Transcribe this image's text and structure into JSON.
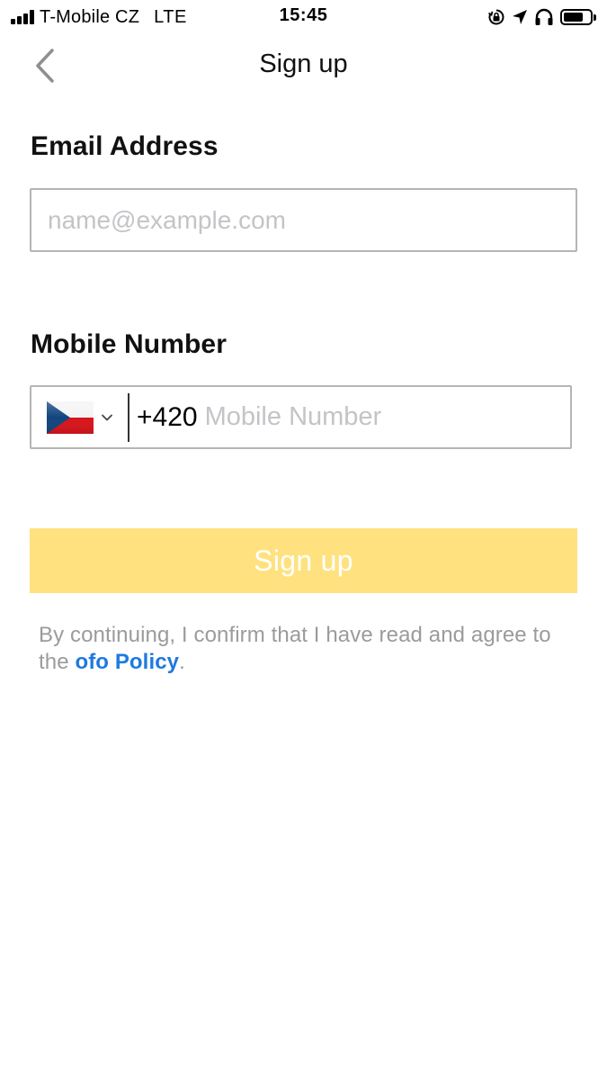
{
  "status_bar": {
    "carrier": "T-Mobile CZ",
    "network": "LTE",
    "time": "15:45",
    "icons": [
      "signal-bars-icon",
      "orientation-lock-icon",
      "location-arrow-icon",
      "headphones-icon",
      "battery-icon"
    ],
    "battery_level": 0.75
  },
  "nav": {
    "back_icon": "chevron-left-icon",
    "title": "Sign up"
  },
  "email": {
    "label": "Email Address",
    "placeholder": "name@example.com",
    "value": ""
  },
  "mobile": {
    "label": "Mobile Number",
    "country_flag": "czech-flag-icon",
    "dial_code": "+420",
    "placeholder": "Mobile Number",
    "value": ""
  },
  "signup_button": {
    "label": "Sign up"
  },
  "terms": {
    "text_before": "By continuing, I confirm that I have read and agree to the ",
    "link_text": "ofo Policy",
    "text_after": "."
  },
  "colors": {
    "button_bg": "#ffe27f",
    "link": "#1f7ae0",
    "muted_text": "#9b9b9b",
    "placeholder": "#c4c4c8",
    "input_border": "#b5b5b5"
  }
}
